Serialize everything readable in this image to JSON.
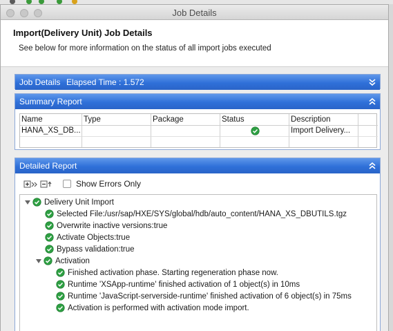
{
  "window": {
    "title": "Job Details"
  },
  "header": {
    "title": "Import(Delivery Unit) Job Details",
    "description": "See below for more information on the status of all import jobs executed"
  },
  "job_details": {
    "label": "Job Details",
    "elapsed": "Elapsed Time : 1.572"
  },
  "summary": {
    "label": "Summary Report",
    "columns": [
      "Name",
      "Type",
      "Package",
      "Status",
      "Description"
    ],
    "rows": [
      {
        "name": "HANA_XS_DB...",
        "type": "",
        "package": "",
        "status": "success",
        "description": "Import Delivery..."
      }
    ]
  },
  "detailed": {
    "label": "Detailed Report",
    "show_errors_label": "Show Errors Only",
    "show_errors_checked": false,
    "tree": {
      "root": "Delivery Unit Import",
      "items": [
        "Selected File:/usr/sap/HXE/SYS/global/hdb/auto_content/HANA_XS_DBUTILS.tgz",
        "Overwrite inactive versions:true",
        "Activate Objects:true",
        "Bypass validation:true"
      ],
      "activation": {
        "label": "Activation",
        "items": [
          "Finished activation phase. Starting regeneration phase now.",
          "Runtime 'XSApp-runtime' finished activation of 1 object(s) in 10ms",
          "Runtime 'JavaScript-serverside-runtime' finished activation of 6 object(s) in 75ms",
          "Activation is performed with activation mode import."
        ]
      }
    }
  },
  "colors": {
    "section_bar": "#2f70d9",
    "success": "#2ea043"
  }
}
